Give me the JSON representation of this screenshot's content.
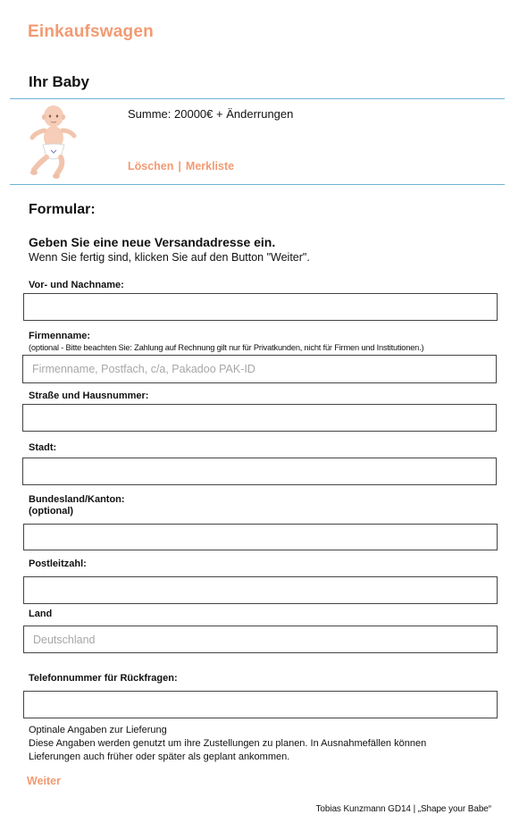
{
  "page": {
    "title": "Einkaufswagen"
  },
  "cart": {
    "heading": "Ihr Baby",
    "summe": "Summe: 20000€ + Änderrungen",
    "delete_label": "Löschen",
    "separator": "|",
    "wishlist_label": "Merkliste"
  },
  "form": {
    "heading": "Formular:",
    "address_heading": "Geben Sie eine neue Versandadresse ein.",
    "address_sub": "Wenn Sie fertig sind, klicken Sie auf den Button \"Weiter\".",
    "fields": {
      "name": {
        "label": "Vor- und Nachname:",
        "value": "",
        "placeholder": ""
      },
      "company": {
        "label": "Firmenname:",
        "hint": "(optional - Bitte beachten Sie: Zahlung auf Rechnung gilt nur für Privatkunden, nicht für Firmen und Institutionen.)",
        "value": "",
        "placeholder": "Firmenname, Postfach, c/a, Pakadoo PAK-ID"
      },
      "street": {
        "label": "Straße und Hausnummer:",
        "value": "",
        "placeholder": ""
      },
      "city": {
        "label": "Stadt:",
        "value": "",
        "placeholder": ""
      },
      "state": {
        "label": "Bundesland/Kanton:",
        "label_optional": "(optional)",
        "value": "",
        "placeholder": ""
      },
      "zip": {
        "label": "Postleitzahl:",
        "value": "",
        "placeholder": ""
      },
      "country": {
        "label": "Land",
        "value": "",
        "placeholder": "Deutschland"
      },
      "phone": {
        "label": "Telefonnummer für Rückfragen:",
        "value": "",
        "placeholder": ""
      }
    },
    "note_line1": "Optinale Angaben zur Lieferung",
    "note_line2": "Diese Angaben werden genutzt um ihre Zustellungen zu planen. In Ausnahmefällen können",
    "note_line3": "Lieferungen auch früher oder später als geplant ankommen.",
    "submit_label": "Weiter"
  },
  "footer": {
    "credit": "Tobias Kunzmann GD14  | „Shape your Babe“"
  },
  "colors": {
    "accent": "#f39a72",
    "divider": "#6fb3d6",
    "border": "#444444"
  },
  "icons": {
    "product_image": "baby-image"
  }
}
